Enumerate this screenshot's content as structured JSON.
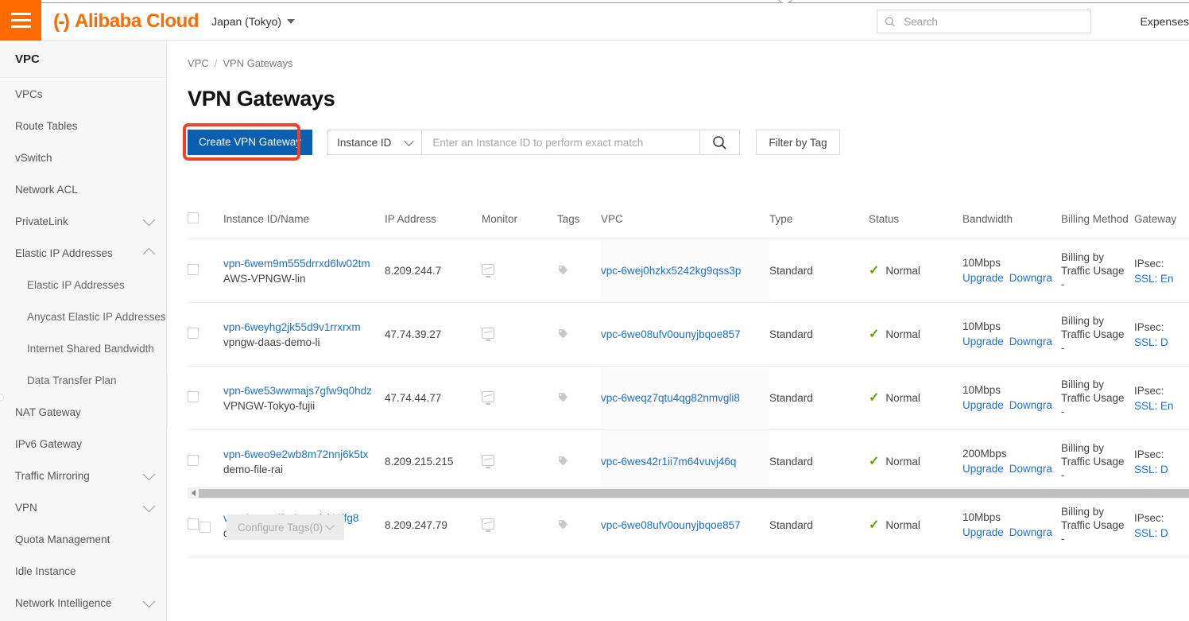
{
  "header": {
    "menu_icon": "hamburger-icon",
    "brand": "Alibaba Cloud",
    "brand_mark": "(-)",
    "region": "Japan (Tokyo)",
    "search_placeholder": "Search",
    "search_value": "",
    "expenses": "Expenses"
  },
  "sidebar": {
    "title": "VPC",
    "items": [
      {
        "label": "VPCs",
        "sub": false,
        "chevron": ""
      },
      {
        "label": "Route Tables",
        "sub": false,
        "chevron": ""
      },
      {
        "label": "vSwitch",
        "sub": false,
        "chevron": ""
      },
      {
        "label": "Network ACL",
        "sub": false,
        "chevron": ""
      },
      {
        "label": "PrivateLink",
        "sub": false,
        "chevron": "down"
      },
      {
        "label": "Elastic IP Addresses",
        "sub": false,
        "chevron": "up"
      },
      {
        "label": "Elastic IP Addresses",
        "sub": true,
        "chevron": ""
      },
      {
        "label": "Anycast Elastic IP Addresses",
        "sub": true,
        "chevron": ""
      },
      {
        "label": "Internet Shared Bandwidth",
        "sub": true,
        "chevron": ""
      },
      {
        "label": "Data Transfer Plan",
        "sub": true,
        "chevron": ""
      },
      {
        "label": "NAT Gateway",
        "sub": false,
        "chevron": ""
      },
      {
        "label": "IPv6 Gateway",
        "sub": false,
        "chevron": ""
      },
      {
        "label": "Traffic Mirroring",
        "sub": false,
        "chevron": "down"
      },
      {
        "label": "VPN",
        "sub": false,
        "chevron": "down"
      },
      {
        "label": "Quota Management",
        "sub": false,
        "chevron": ""
      },
      {
        "label": "Idle Instance",
        "sub": false,
        "chevron": ""
      },
      {
        "label": "Network Intelligence",
        "sub": false,
        "chevron": "down"
      }
    ],
    "collapse_icon": "chevron-left-icon"
  },
  "breadcrumb": {
    "root": "VPC",
    "separator": "/",
    "current": "VPN Gateways"
  },
  "page_title": "VPN Gateways",
  "toolbar": {
    "create_label": "Create VPN Gateway",
    "highlight_color": "#f4402a",
    "button_color": "#0b5fb0",
    "filter_select": "Instance ID",
    "search_placeholder": "Enter an Instance ID to perform exact match",
    "search_value": "",
    "search_icon": "search-icon",
    "filter_by_tag": "Filter by Tag"
  },
  "table": {
    "columns": [
      "Instance ID/Name",
      "IP Address",
      "Monitor",
      "Tags",
      "VPC",
      "Type",
      "Status",
      "Bandwidth",
      "Billing Method",
      "Gateway"
    ],
    "bandwidth_upgrade": "Upgrade",
    "bandwidth_downgrade": "Downgra",
    "status_check_color": "#58a700",
    "rows": [
      {
        "instance_id": "vpn-6wem9m555drrxd6lw02tm",
        "name": "AWS-VPNGW-lin",
        "ip": "8.209.244.7",
        "vpc": "vpc-6wej0hzkx5242kg9qss3p",
        "type": "Standard",
        "status": "Normal",
        "bandwidth": "10Mbps",
        "billing": "Billing by Traffic Usage",
        "billing_sub": "-",
        "gateway_ipsec": "IPsec:",
        "gateway_ssl": "SSL: En"
      },
      {
        "instance_id": "vpn-6weyhg2jk55d9v1rrxrxm",
        "name": "vpngw-daas-demo-li",
        "ip": "47.74.39.27",
        "vpc": "vpc-6we08ufv0ounyjbqoe857",
        "type": "Standard",
        "status": "Normal",
        "bandwidth": "10Mbps",
        "billing": "Billing by Traffic Usage",
        "billing_sub": "-",
        "gateway_ipsec": "IPsec:",
        "gateway_ssl": "SSL: D"
      },
      {
        "instance_id": "vpn-6we53wwmajs7gfw9q0hdz",
        "name": "VPNGW-Tokyo-fujii",
        "ip": "47.74.44.77",
        "vpc": "vpc-6weqz7qtu4qg82nmvgli8",
        "type": "Standard",
        "status": "Normal",
        "bandwidth": "10Mbps",
        "billing": "Billing by Traffic Usage",
        "billing_sub": "-",
        "gateway_ipsec": "IPsec:",
        "gateway_ssl": "SSL: En"
      },
      {
        "instance_id": "vpn-6weo9e2wb8m72nnj6k5tx",
        "name": "demo-file-rai",
        "ip": "8.209.215.215",
        "vpc": "vpc-6wes42r1ii7m64vuvj46q",
        "type": "Standard",
        "status": "Normal",
        "bandwidth": "200Mbps",
        "billing": "Billing by Traffic Usage",
        "billing_sub": "-",
        "gateway_ipsec": "IPsec:",
        "gateway_ssl": "SSL: D"
      },
      {
        "instance_id": "vpn-6weuq6by9ocmixj41ifg8",
        "name": "daas-demo-vpn-lin",
        "ip": "8.209.247.79",
        "vpc": "vpc-6we08ufv0ounyjbqoe857",
        "type": "Standard",
        "status": "Normal",
        "bandwidth": "10Mbps",
        "billing": "Billing by Traffic Usage",
        "billing_sub": "-",
        "gateway_ipsec": "IPsec:",
        "gateway_ssl": "SSL: D"
      }
    ]
  },
  "bottom": {
    "configure_tags": "Configure Tags(0)"
  }
}
